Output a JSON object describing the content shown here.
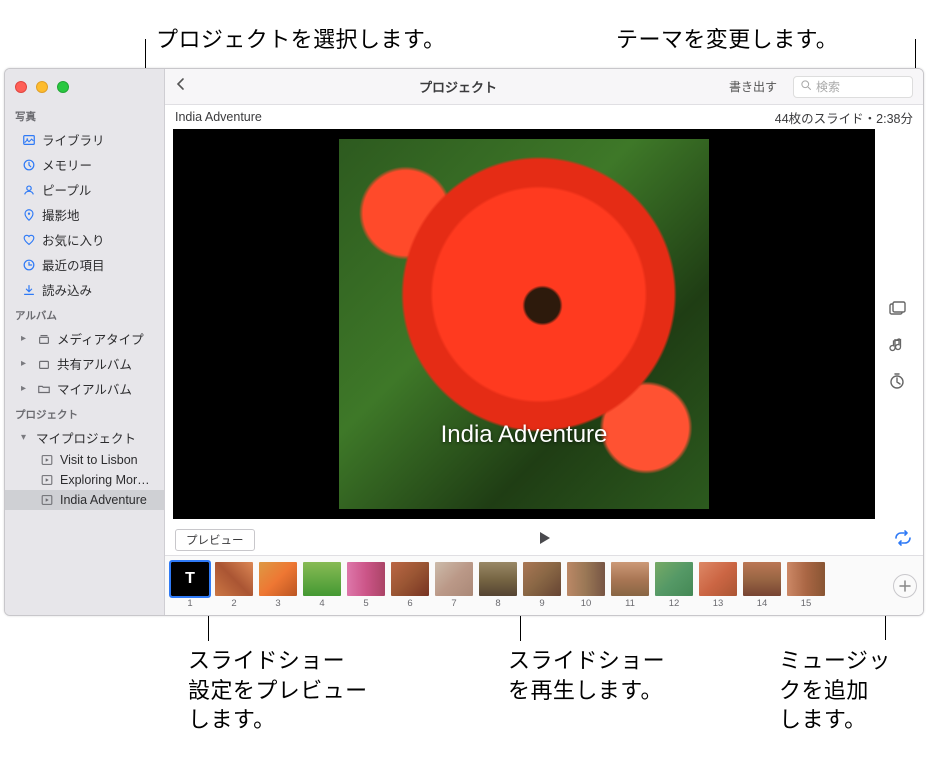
{
  "annotations": {
    "select_project": "プロジェクトを選択します。",
    "change_theme": "テーマを変更します。",
    "preview_settings_l1": "スライドショー",
    "preview_settings_l2": "設定をプレビュー",
    "preview_settings_l3": "します。",
    "play_l1": "スライドショー",
    "play_l2": "を再生します。",
    "add_music_l1": "ミュージッ",
    "add_music_l2": "クを追加",
    "add_music_l3": "します。"
  },
  "toolbar": {
    "title": "プロジェクト",
    "export": "書き出す",
    "search_placeholder": "検索"
  },
  "sidebar": {
    "sec_photos": "写真",
    "library": "ライブラリ",
    "memories": "メモリー",
    "people": "ピープル",
    "places": "撮影地",
    "favorites": "お気に入り",
    "recent": "最近の項目",
    "imports": "読み込み",
    "sec_albums": "アルバム",
    "media_types": "メディアタイプ",
    "shared": "共有アルバム",
    "my_albums": "マイアルバム",
    "sec_projects": "プロジェクト",
    "my_projects": "マイプロジェクト",
    "proj1": "Visit to Lisbon",
    "proj2": "Exploring Mor…",
    "proj3": "India Adventure"
  },
  "info": {
    "project_name": "India Adventure",
    "status": "44枚のスライド・2:38分"
  },
  "slide_title": "India Adventure",
  "controls": {
    "preview": "プレビュー"
  },
  "thumbs": [
    "1",
    "2",
    "3",
    "4",
    "5",
    "6",
    "7",
    "8",
    "9",
    "10",
    "11",
    "12",
    "13",
    "14",
    "15"
  ]
}
